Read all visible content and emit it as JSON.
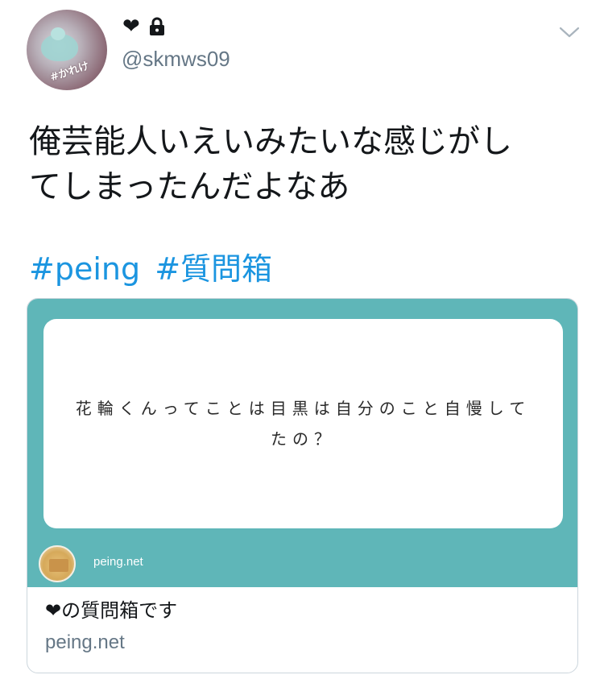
{
  "user": {
    "display_name": "❤",
    "handle": "@skmws09",
    "avatar_tag": "#かれけ"
  },
  "tweet": {
    "text_lines": [
      "俺芸能人いえいみたいな感じがし",
      "てしまったんだよなあ"
    ],
    "hashtags": [
      "#peing",
      "#質問箱"
    ]
  },
  "card": {
    "question_lines": [
      "花輪くんってことは目黒は自分のこと自慢して",
      "たの？"
    ],
    "site_label": "peing.net",
    "title": "❤の質問箱です",
    "domain": "peing.net"
  },
  "colors": {
    "link": "#1b95e0",
    "card_accent": "#5fb6b8",
    "secondary_text": "#657786"
  },
  "icons": [
    "lock-icon",
    "chevron-down-icon",
    "heart-icon"
  ]
}
